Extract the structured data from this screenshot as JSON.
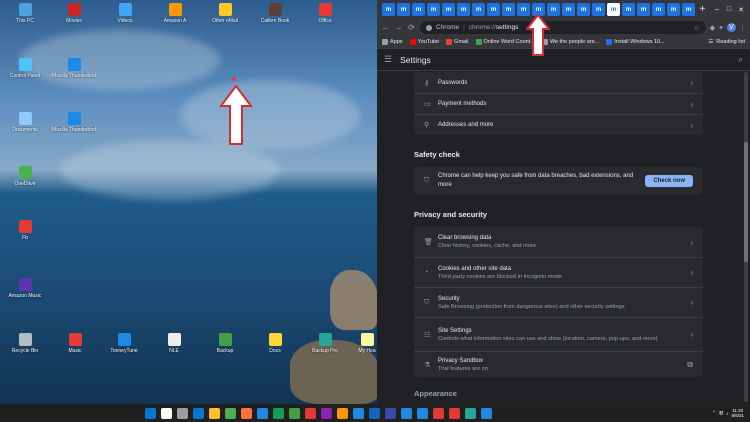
{
  "desktop": {
    "icons_top": [
      {
        "label": "This PC",
        "color": "#4aa3df"
      },
      {
        "label": "Movies",
        "color": "#c62828"
      },
      {
        "label": "Videos",
        "color": "#42a5f5"
      },
      {
        "label": "Amazon A",
        "color": "#ff9800"
      },
      {
        "label": "Other eMail",
        "color": "#ffca28"
      },
      {
        "label": "Calibre Book",
        "color": "#5d4037"
      },
      {
        "label": "Office",
        "color": "#e53935"
      }
    ],
    "icons_left": [
      {
        "label": "Control Panel",
        "color": "#4fc3f7"
      },
      {
        "label": "Mozilla Thunderbird",
        "color": "#1e88e5"
      },
      {
        "label": "Documents",
        "color": "#90caf9"
      },
      {
        "label": "Mozilla Thunderbird",
        "color": "#1e88e5"
      },
      {
        "label": "OneDrive",
        "color": "#4caf50"
      },
      {
        "label": "Fb",
        "color": "#e53935"
      },
      {
        "label": "Amazon Music",
        "color": "#5e35b1"
      }
    ],
    "icons_bottom": [
      {
        "label": "Recycle Bin",
        "color": "#b0bec5"
      },
      {
        "label": "Music",
        "color": "#e53935"
      },
      {
        "label": "TonneyTune",
        "color": "#1e88e5"
      },
      {
        "label": "NLE",
        "color": "#eeeeee"
      },
      {
        "label": "Backup",
        "color": "#43a047"
      },
      {
        "label": "Docs",
        "color": "#fdd835"
      },
      {
        "label": "Backup Pro",
        "color": "#26a69a"
      },
      {
        "label": "My Hea",
        "color": "#fff59d"
      }
    ]
  },
  "chrome": {
    "tab_glyph": "m",
    "tab_count": 21,
    "active_tab_index": 15,
    "new_tab": "+",
    "window_controls": [
      "–",
      "□",
      "✕"
    ],
    "toolbar": {
      "back": "←",
      "forward": "→",
      "reload": "⟳",
      "site_name": "Chrome",
      "separator": "|",
      "url_prefix": "chrome://",
      "url_path": "settings"
    },
    "bookmarks": [
      {
        "label": "Apps",
        "color": "#9aa0a6"
      },
      {
        "label": "YouTube",
        "color": "#ff0000"
      },
      {
        "label": "Gmail",
        "color": "#ea4335"
      },
      {
        "label": "Online Word Count...",
        "color": "#34a853"
      },
      {
        "label": "We the people are...",
        "color": "#9aa0a6"
      },
      {
        "label": "Install Windows 10...",
        "color": "#1a73e8"
      }
    ],
    "reading_list": "Reading list"
  },
  "settings": {
    "title": "Settings",
    "autofill_rows": [
      {
        "icon": "key",
        "label": "Passwords"
      },
      {
        "icon": "card",
        "label": "Payment methods"
      },
      {
        "icon": "pin",
        "label": "Addresses and more"
      }
    ],
    "safety_check": {
      "title": "Safety check",
      "text": "Chrome can help keep you safe from data breaches, bad extensions, and more",
      "button": "Check now"
    },
    "privacy": {
      "title": "Privacy and security",
      "rows": [
        {
          "label": "Clear browsing data",
          "sub": "Clear history, cookies, cache, and more"
        },
        {
          "label": "Cookies and other site data",
          "sub": "Third-party cookies are blocked in Incognito mode"
        },
        {
          "label": "Security",
          "sub": "Safe Browsing (protection from dangerous sites) and other security settings"
        },
        {
          "label": "Site Settings",
          "sub": "Controls what information sites can use and show (location, camera, pop-ups, and more)"
        },
        {
          "label": "Privacy Sandbox",
          "sub": "Trial features are on"
        }
      ]
    },
    "next_section": "Appearance"
  },
  "taskbar": {
    "time": "11:32",
    "date": "8/5/21",
    "icon_colors": [
      "#0078d4",
      "#ffffff",
      "#9e9e9e",
      "#0078d4",
      "#fbc02d",
      "#4caf50",
      "#ff7043",
      "#1e88e5",
      "#0f9d58",
      "#43a047",
      "#e53935",
      "#8e24aa",
      "#ff9800",
      "#1e88e5",
      "#1565c0",
      "#3949ab",
      "#1e88e5",
      "#1e88e5",
      "#e53935",
      "#e53935",
      "#26a69a",
      "#1e88e5"
    ]
  }
}
